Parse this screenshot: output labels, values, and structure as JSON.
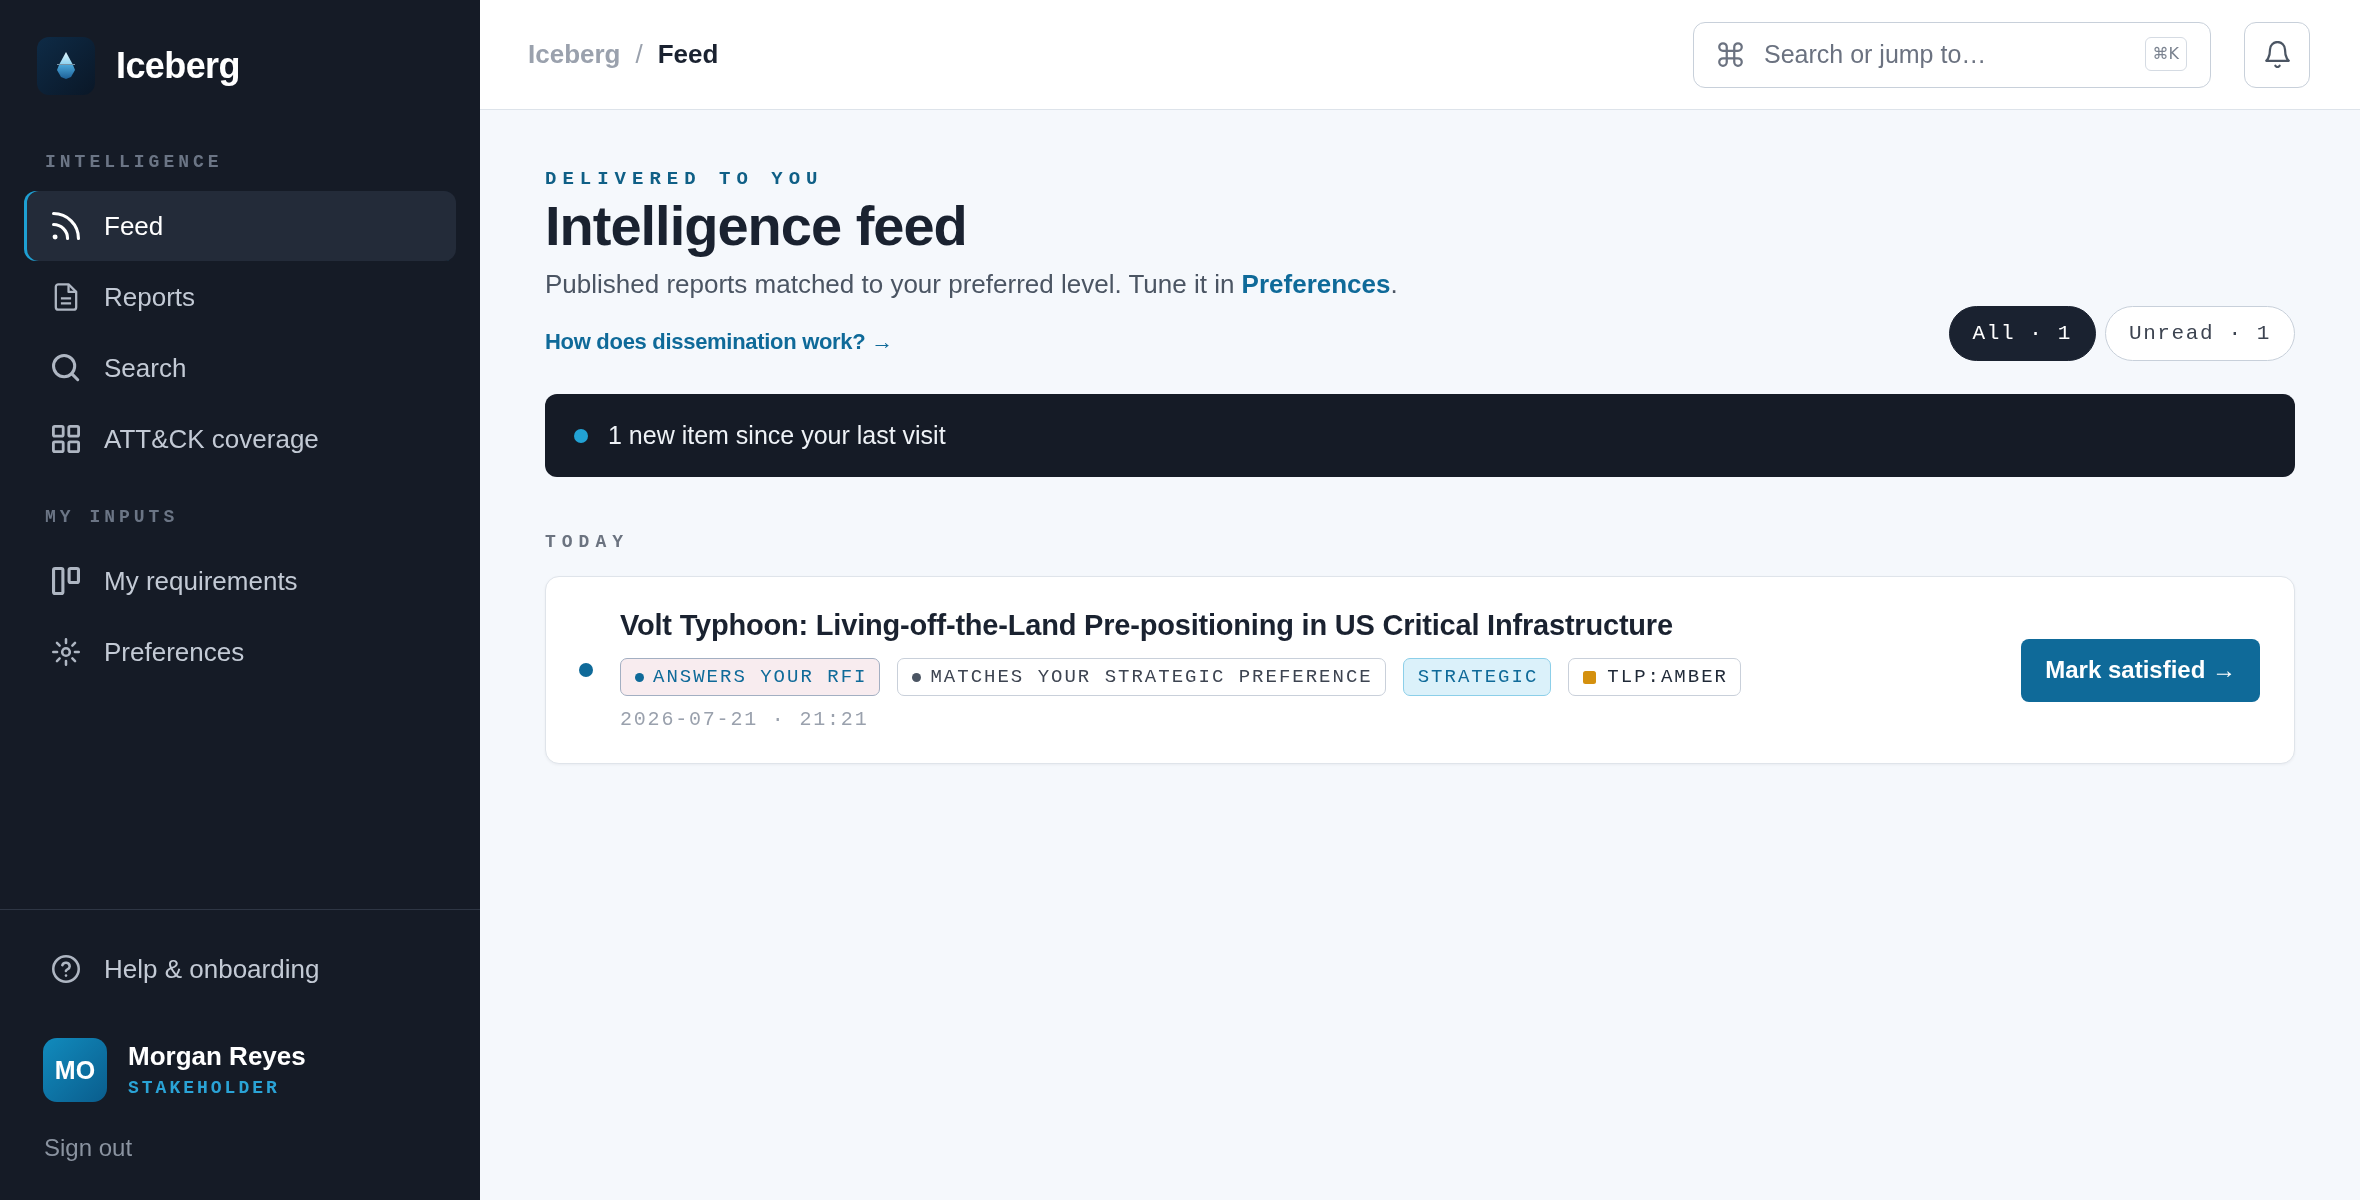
{
  "sidebar": {
    "brand": {
      "name": "Iceberg"
    },
    "sections": [
      {
        "label": "INTELLIGENCE",
        "items": [
          {
            "label": "Feed",
            "selected": true
          },
          {
            "label": "Reports",
            "selected": false
          },
          {
            "label": "Search",
            "selected": false
          },
          {
            "label": "ATT&CK coverage",
            "selected": false
          }
        ]
      },
      {
        "label": "MY INPUTS",
        "items": [
          {
            "label": "My requirements",
            "selected": false
          },
          {
            "label": "Preferences",
            "selected": false
          }
        ]
      }
    ],
    "help": {
      "label": "Help & onboarding"
    },
    "user": {
      "initials": "MO",
      "name": "Morgan Reyes",
      "role": "STAKEHOLDER"
    },
    "sign_out": "Sign out"
  },
  "topbar": {
    "breadcrumb": [
      "Iceberg",
      "Feed"
    ],
    "separator": "/",
    "search": {
      "placeholder": "Search or jump to…",
      "shortcut": "⌘K"
    }
  },
  "header": {
    "eyebrow": "DELIVERED TO YOU",
    "title": "Intelligence feed",
    "subtitle": "Published reports matched to your preferred level. Tune it in ",
    "subtitle_link": "Preferences",
    "subtitle_end": ".",
    "help_link": "How does dissemination work? →"
  },
  "filters": [
    {
      "label": "All · 1",
      "selected": true
    },
    {
      "label": "Unread · 1",
      "selected": false
    }
  ],
  "banner": {
    "text": "1 new item since your last visit"
  },
  "groups": [
    {
      "label": "TODAY",
      "items": [
        {
          "title": "Volt Typhoon: Living-off-the-Land Pre-positioning in US Critical Infrastructure",
          "unread": true,
          "tags": [
            {
              "kind": "rfi",
              "label": "ANSWERS YOUR RFI",
              "color": "#0f6a99"
            },
            {
              "kind": "match",
              "label": "MATCHES YOUR STRATEGIC PREFERENCE",
              "color": "#4b5563"
            },
            {
              "kind": "level",
              "label": "STRATEGIC"
            },
            {
              "kind": "tlp",
              "label": "TLP:AMBER",
              "color": "#d4900e"
            }
          ],
          "time": "2026-07-21 · 21:21",
          "action": "Mark satisfied →"
        }
      ]
    }
  ]
}
